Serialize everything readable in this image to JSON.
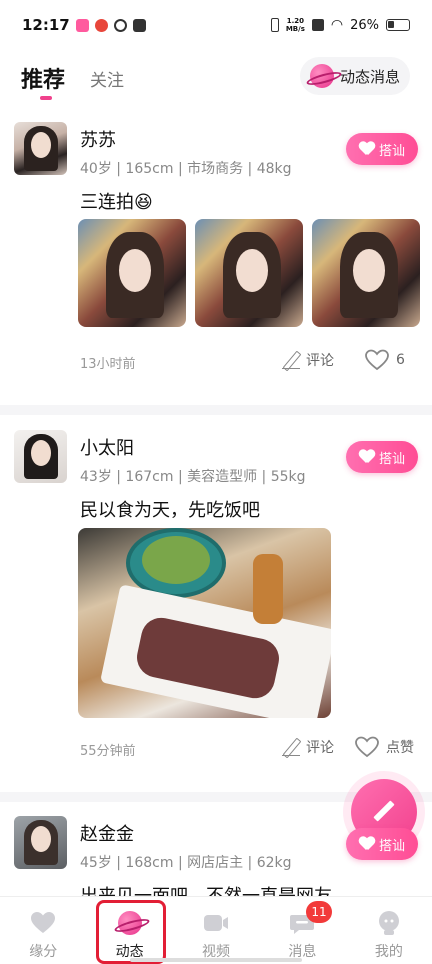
{
  "status_bar": {
    "time": "12:17",
    "speed_value": "1.20",
    "speed_unit": "MB/s",
    "battery": "26%"
  },
  "header": {
    "tab_recommend": "推荐",
    "tab_follow": "关注",
    "dynamic_messages": "动态消息"
  },
  "posts": [
    {
      "name": "苏苏",
      "meta": "40岁 | 165cm | 市场商务 | 48kg",
      "text": "三连拍😆",
      "time": "13小时前",
      "comment_label": "评论",
      "like_label": "6",
      "greet_label": "搭讪"
    },
    {
      "name": "小太阳",
      "meta": "43岁 | 167cm | 美容造型师 | 55kg",
      "text": "民以食为天，先吃饭吧",
      "time": "55分钟前",
      "comment_label": "评论",
      "like_label": "点赞",
      "greet_label": "搭讪"
    },
    {
      "name": "赵金金",
      "meta": "45岁 | 168cm | 网店店主 | 62kg",
      "text": "出来见一面吧，不然一直是网友",
      "greet_label": "搭讪"
    }
  ],
  "tabbar": {
    "items": [
      {
        "label": "缘分",
        "icon": "heart-icon"
      },
      {
        "label": "动态",
        "icon": "planet-icon"
      },
      {
        "label": "视频",
        "icon": "video-icon"
      },
      {
        "label": "消息",
        "icon": "message-icon"
      },
      {
        "label": "我的",
        "icon": "profile-icon"
      }
    ],
    "active": "动态",
    "message_badge": "11"
  },
  "colors": {
    "accent": "#f0418c",
    "badge": "#f23a3a",
    "highlight_box": "#e21e35"
  }
}
